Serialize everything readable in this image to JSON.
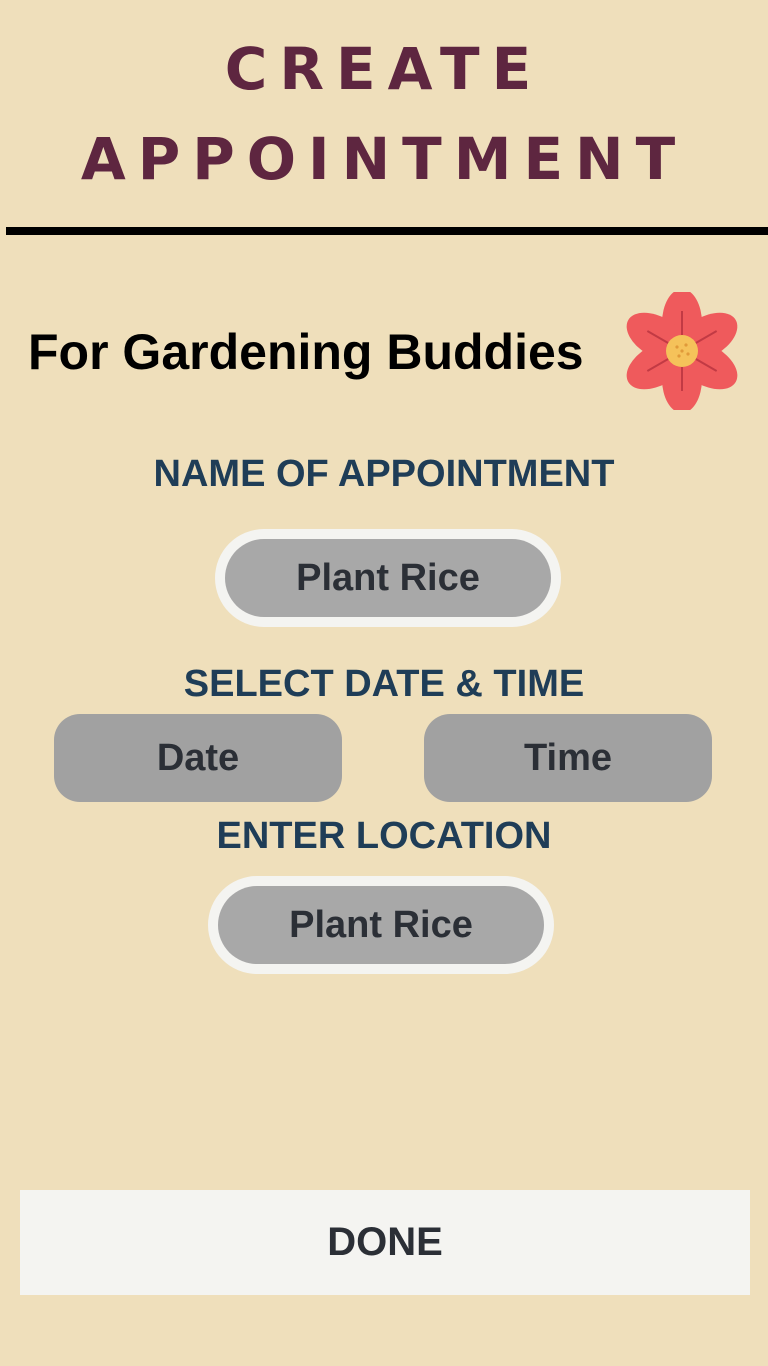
{
  "header": {
    "title_line1": "CREATE",
    "title_line2": "APPOINTMENT"
  },
  "subtitle": "For Gardening Buddies",
  "flower_icon": "flower-icon",
  "name_section": {
    "label": "NAME OF APPOINTMENT",
    "value": "Plant Rice"
  },
  "datetime_section": {
    "label": "SELECT DATE & TIME",
    "date_label": "Date",
    "time_label": "Time"
  },
  "location_section": {
    "label": "ENTER LOCATION",
    "value": "Plant Rice"
  },
  "done_label": "DONE",
  "colors": {
    "background": "#efdfbb",
    "title": "#5e2640",
    "section_label": "#1f3d57",
    "pill": "#a8a8a8",
    "flower_petal": "#ef5a5c",
    "flower_center": "#f5c25a"
  }
}
